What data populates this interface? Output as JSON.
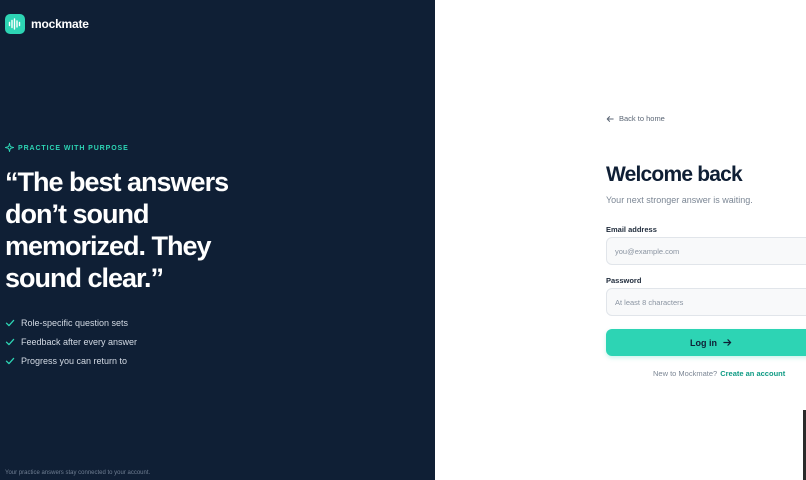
{
  "brand": {
    "name": "mockmate",
    "logo_icon": "waveform-icon"
  },
  "hero": {
    "eyebrow": "PRACTICE WITH PURPOSE",
    "eyebrow_icon": "sparkle-icon",
    "quote": "“The best answers don’t sound memorized. They sound clear.”",
    "features": [
      {
        "label": "Role-specific question sets",
        "icon": "check-icon"
      },
      {
        "label": "Feedback after every answer",
        "icon": "check-icon"
      },
      {
        "label": "Progress you can return to",
        "icon": "check-icon"
      }
    ],
    "footer": "Your practice answers stay connected to your account."
  },
  "login": {
    "back_label": "Back to home",
    "back_icon": "arrow-left-icon",
    "title": "Welcome back",
    "subtitle": "Your next stronger answer is waiting.",
    "email": {
      "label": "Email address",
      "placeholder": "you@example.com",
      "value": ""
    },
    "password": {
      "label": "Password",
      "placeholder": "At least 8 characters",
      "value": ""
    },
    "submit_label": "Log in",
    "submit_icon": "arrow-right-icon",
    "signup_prompt": "New to Mockmate?",
    "signup_link": "Create an account"
  },
  "colors": {
    "panel_dark": "#0f1f35",
    "accent": "#2dd4b4",
    "link": "#0f9b84"
  }
}
